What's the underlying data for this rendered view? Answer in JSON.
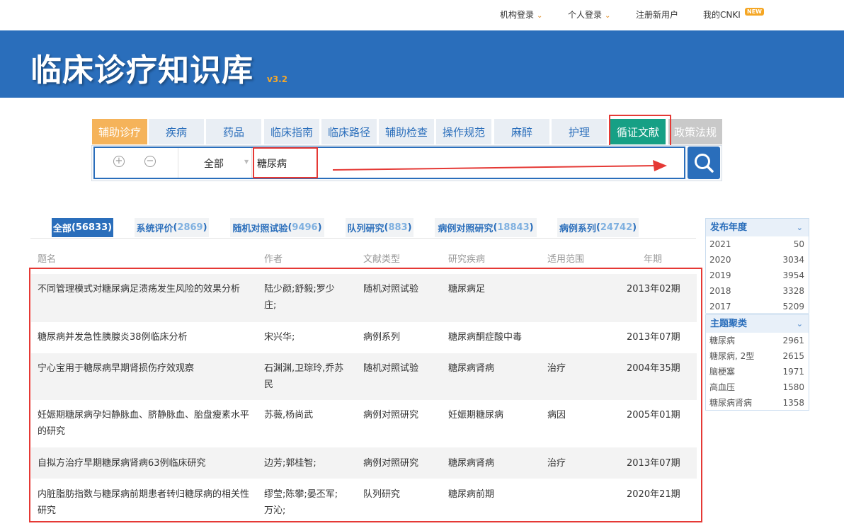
{
  "top_nav": {
    "institution_login": "机构登录",
    "personal_login": "个人登录",
    "register": "注册新用户",
    "my_cnki": "我的CNKI",
    "new_badge": "NEW"
  },
  "banner": {
    "title": "临床诊疗知识库",
    "version": "v3.2"
  },
  "colors": {
    "brand_blue": "#2a6ebb",
    "accent_orange": "#f5b35a",
    "evidence_green": "#16a085",
    "highlight_red": "#e53935"
  },
  "tabs": [
    "辅助诊疗",
    "疾病",
    "药品",
    "临床指南",
    "临床路径",
    "辅助检查",
    "操作规范",
    "麻醉",
    "护理",
    "循证文献",
    "政策法规"
  ],
  "search": {
    "scope": "全部",
    "query": "糖尿病",
    "plus_icon": "plus-circle-icon",
    "minus_icon": "minus-circle-icon",
    "search_icon": "search-icon"
  },
  "filters": [
    {
      "label": "全部",
      "count": "56833"
    },
    {
      "label": "系统评价",
      "count": "2869"
    },
    {
      "label": "随机对照试验",
      "count": "9496"
    },
    {
      "label": "队列研究",
      "count": "883"
    },
    {
      "label": "病例对照研究",
      "count": "18843"
    },
    {
      "label": "病例系列",
      "count": "24742"
    }
  ],
  "table": {
    "headers": [
      "题名",
      "作者",
      "文献类型",
      "研究疾病",
      "适用范围",
      "年期"
    ],
    "rows": [
      {
        "title": "不同管理模式对糖尿病足溃疡发生风险的效果分析",
        "author": "陆少颜;舒毅;罗少庄;",
        "type": "随机对照试验",
        "disease": "糖尿病足",
        "scope": "",
        "period": "2013年02期"
      },
      {
        "title": "糖尿病并发急性胰腺炎38例临床分析",
        "author": "宋兴华;",
        "type": "病例系列",
        "disease": "糖尿病酮症酸中毒",
        "scope": "",
        "period": "2013年07期"
      },
      {
        "title": "宁心宝用于糖尿病早期肾损伤疗效观察",
        "author": "石渊渊,卫琮玲,乔苏民",
        "type": "随机对照试验",
        "disease": "糖尿病肾病",
        "scope": "治疗",
        "period": "2004年35期"
      },
      {
        "title": "妊娠期糖尿病孕妇静脉血、脐静脉血、胎盘瘦素水平的研究",
        "author": "苏薇,杨尚武",
        "type": "病例对照研究",
        "disease": "妊娠期糖尿病",
        "scope": "病因",
        "period": "2005年01期"
      },
      {
        "title": "自拟方治疗早期糖尿病肾病63例临床研究",
        "author": "边芳;郭桂智;",
        "type": "病例对照研究",
        "disease": "糖尿病肾病",
        "scope": "治疗",
        "period": "2013年07期"
      },
      {
        "title": "内脏脂肪指数与糖尿病前期患者转归糖尿病的相关性研究",
        "author": "缪莹;陈攀;晏丕军;万沁;",
        "type": "队列研究",
        "disease": "糖尿病前期",
        "scope": "",
        "period": "2020年21期"
      }
    ]
  },
  "sidebar": {
    "year_title": "发布年度",
    "years": [
      {
        "label": "2021",
        "count": "50"
      },
      {
        "label": "2020",
        "count": "3034"
      },
      {
        "label": "2019",
        "count": "3954"
      },
      {
        "label": "2018",
        "count": "3328"
      },
      {
        "label": "2017",
        "count": "5209"
      }
    ],
    "topic_title": "主题聚类",
    "topics": [
      {
        "label": "糖尿病",
        "count": "2961"
      },
      {
        "label": "糖尿病, 2型",
        "count": "2615"
      },
      {
        "label": "脑梗塞",
        "count": "1971"
      },
      {
        "label": "高血压",
        "count": "1580"
      },
      {
        "label": "糖尿病肾病",
        "count": "1358"
      }
    ]
  }
}
